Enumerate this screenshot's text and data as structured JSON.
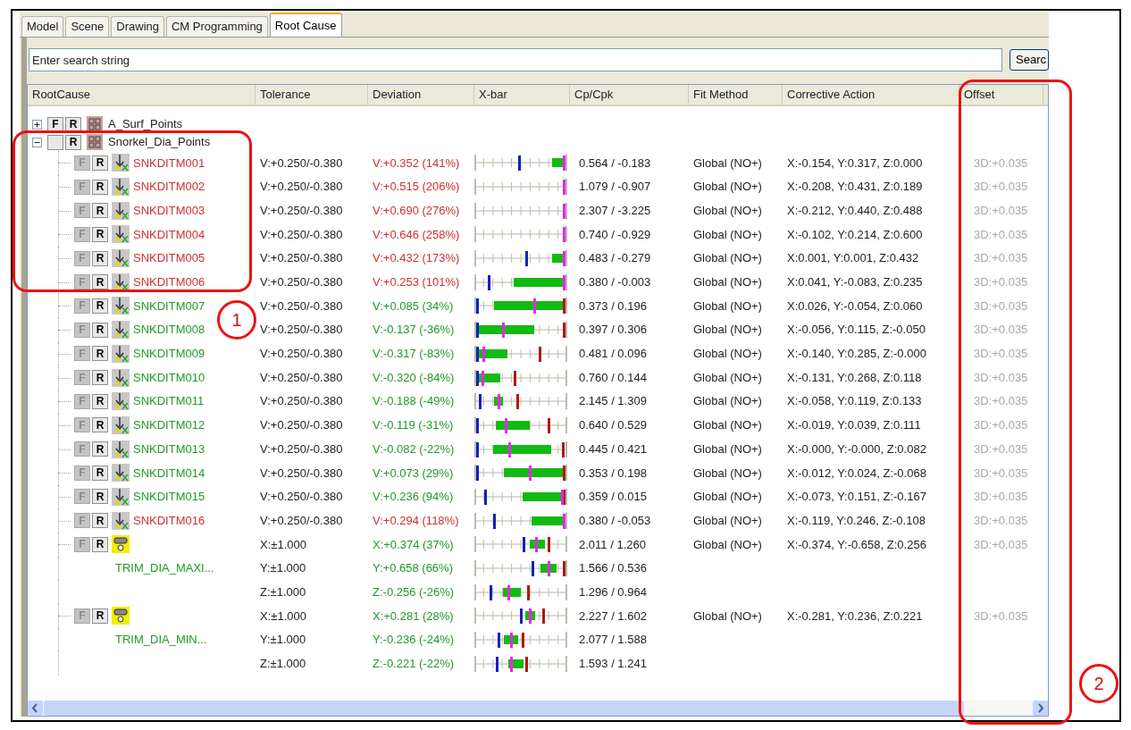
{
  "tabs": [
    {
      "label": "Model",
      "selected": false
    },
    {
      "label": "Scene",
      "selected": false
    },
    {
      "label": "Drawing",
      "selected": false
    },
    {
      "label": "CM Programming",
      "selected": false
    },
    {
      "label": "Root Cause",
      "selected": true
    }
  ],
  "search": {
    "placeholder": "Enter search string",
    "button": "Searc"
  },
  "columns": [
    "RootCause",
    "Tolerance",
    "Deviation",
    "X-bar",
    "Cp/Cpk",
    "Fit Method",
    "Corrective Action",
    "Offset"
  ],
  "tree": [
    {
      "kind": "group",
      "name": "A_Surf_Points",
      "expanded": false,
      "flags": [
        {
          "label": "F",
          "disabled": false
        },
        {
          "label": "R",
          "disabled": false
        }
      ]
    },
    {
      "kind": "group",
      "name": "Snorkel_Dia_Points",
      "expanded": true,
      "flags": [
        {
          "disabled": false
        },
        {
          "label": "R",
          "disabled": false
        }
      ],
      "children": [
        {
          "kind": "point",
          "name": "SNKDITM001",
          "out_of_tolerance": true,
          "tolerance": "V:+0.250/-0.380",
          "deviation": "V:+0.352 (141%)",
          "cp": "0.564 / -0.183",
          "fit": "Global (NO+)",
          "action": "X:-0.154, Y:0.317, Z:0.000",
          "offset": "3D:+0.035",
          "flags": [
            {
              "label": "F",
              "disabled": true
            },
            {
              "label": "R",
              "disabled": false
            }
          ]
        },
        {
          "kind": "point",
          "name": "SNKDITM002",
          "out_of_tolerance": true,
          "tolerance": "V:+0.250/-0.380",
          "deviation": "V:+0.515 (206%)",
          "cp": "1.079 / -0.907",
          "fit": "Global (NO+)",
          "action": "X:-0.208, Y:0.431, Z:0.189",
          "offset": "3D:+0.035",
          "flags": [
            {
              "label": "F",
              "disabled": true
            },
            {
              "label": "R",
              "disabled": false
            }
          ]
        },
        {
          "kind": "point",
          "name": "SNKDITM003",
          "out_of_tolerance": true,
          "tolerance": "V:+0.250/-0.380",
          "deviation": "V:+0.690 (276%)",
          "cp": "2.307 / -3.225",
          "fit": "Global (NO+)",
          "action": "X:-0.212, Y:0.440, Z:0.488",
          "offset": "3D:+0.035",
          "flags": [
            {
              "label": "F",
              "disabled": true
            },
            {
              "label": "R",
              "disabled": false
            }
          ]
        },
        {
          "kind": "point",
          "name": "SNKDITM004",
          "out_of_tolerance": true,
          "tolerance": "V:+0.250/-0.380",
          "deviation": "V:+0.646 (258%)",
          "cp": "0.740 / -0.929",
          "fit": "Global (NO+)",
          "action": "X:-0.102, Y:0.214, Z:0.600",
          "offset": "3D:+0.035",
          "flags": [
            {
              "label": "F",
              "disabled": true
            },
            {
              "label": "R",
              "disabled": false
            }
          ]
        },
        {
          "kind": "point",
          "name": "SNKDITM005",
          "out_of_tolerance": true,
          "tolerance": "V:+0.250/-0.380",
          "deviation": "V:+0.432 (173%)",
          "cp": "0.483 / -0.279",
          "fit": "Global (NO+)",
          "action": "X:0.001, Y:0.001, Z:0.432",
          "offset": "3D:+0.035",
          "flags": [
            {
              "label": "F",
              "disabled": true
            },
            {
              "label": "R",
              "disabled": false
            }
          ]
        },
        {
          "kind": "point",
          "name": "SNKDITM006",
          "out_of_tolerance": true,
          "tolerance": "V:+0.250/-0.380",
          "deviation": "V:+0.253 (101%)",
          "cp": "0.380 / -0.003",
          "fit": "Global (NO+)",
          "action": "X:0.041, Y:-0.083, Z:0.235",
          "offset": "3D:+0.035",
          "flags": [
            {
              "label": "F",
              "disabled": true
            },
            {
              "label": "R",
              "disabled": false
            }
          ]
        },
        {
          "kind": "point",
          "name": "SNKDITM007",
          "out_of_tolerance": false,
          "tolerance": "V:+0.250/-0.380",
          "deviation": "V:+0.085 (34%)",
          "cp": "0.373 / 0.196",
          "fit": "Global (NO+)",
          "action": "X:0.026, Y:-0.054, Z:0.060",
          "offset": "3D:+0.035",
          "flags": [
            {
              "label": "F",
              "disabled": true
            },
            {
              "label": "R",
              "disabled": false
            }
          ]
        },
        {
          "kind": "point",
          "name": "SNKDITM008",
          "out_of_tolerance": false,
          "tolerance": "V:+0.250/-0.380",
          "deviation": "V:-0.137 (-36%)",
          "cp": "0.397 / 0.306",
          "fit": "Global (NO+)",
          "action": "X:-0.056, Y:0.115, Z:-0.050",
          "offset": "3D:+0.035",
          "flags": [
            {
              "label": "F",
              "disabled": true
            },
            {
              "label": "R",
              "disabled": false
            }
          ]
        },
        {
          "kind": "point",
          "name": "SNKDITM009",
          "out_of_tolerance": false,
          "tolerance": "V:+0.250/-0.380",
          "deviation": "V:-0.317 (-83%)",
          "cp": "0.481 / 0.096",
          "fit": "Global (NO+)",
          "action": "X:-0.140, Y:0.285, Z:-0.000",
          "offset": "3D:+0.035",
          "flags": [
            {
              "label": "F",
              "disabled": true
            },
            {
              "label": "R",
              "disabled": false
            }
          ]
        },
        {
          "kind": "point",
          "name": "SNKDITM010",
          "out_of_tolerance": false,
          "tolerance": "V:+0.250/-0.380",
          "deviation": "V:-0.320 (-84%)",
          "cp": "0.760 / 0.144",
          "fit": "Global (NO+)",
          "action": "X:-0.131, Y:0.268, Z:0.118",
          "offset": "3D:+0.035",
          "flags": [
            {
              "label": "F",
              "disabled": true
            },
            {
              "label": "R",
              "disabled": false
            }
          ]
        },
        {
          "kind": "point",
          "name": "SNKDITM011",
          "out_of_tolerance": false,
          "tolerance": "V:+0.250/-0.380",
          "deviation": "V:-0.188 (-49%)",
          "cp": "2.145 / 1.309",
          "fit": "Global (NO+)",
          "action": "X:-0.058, Y:0.119, Z:0.133",
          "offset": "3D:+0.035",
          "flags": [
            {
              "label": "F",
              "disabled": true
            },
            {
              "label": "R",
              "disabled": false
            }
          ]
        },
        {
          "kind": "point",
          "name": "SNKDITM012",
          "out_of_tolerance": false,
          "tolerance": "V:+0.250/-0.380",
          "deviation": "V:-0.119 (-31%)",
          "cp": "0.640 / 0.529",
          "fit": "Global (NO+)",
          "action": "X:-0.019, Y:0.039, Z:0.111",
          "offset": "3D:+0.035",
          "flags": [
            {
              "label": "F",
              "disabled": true
            },
            {
              "label": "R",
              "disabled": false
            }
          ]
        },
        {
          "kind": "point",
          "name": "SNKDITM013",
          "out_of_tolerance": false,
          "tolerance": "V:+0.250/-0.380",
          "deviation": "V:-0.082 (-22%)",
          "cp": "0.445 / 0.421",
          "fit": "Global (NO+)",
          "action": "X:-0.000, Y:-0.000, Z:0.082",
          "offset": "3D:+0.035",
          "flags": [
            {
              "label": "F",
              "disabled": true
            },
            {
              "label": "R",
              "disabled": false
            }
          ]
        },
        {
          "kind": "point",
          "name": "SNKDITM014",
          "out_of_tolerance": false,
          "tolerance": "V:+0.250/-0.380",
          "deviation": "V:+0.073 (29%)",
          "cp": "0.353 / 0.198",
          "fit": "Global (NO+)",
          "action": "X:-0.012, Y:0.024, Z:-0.068",
          "offset": "3D:+0.035",
          "flags": [
            {
              "label": "F",
              "disabled": true
            },
            {
              "label": "R",
              "disabled": false
            }
          ]
        },
        {
          "kind": "point",
          "name": "SNKDITM015",
          "out_of_tolerance": false,
          "tolerance": "V:+0.250/-0.380",
          "deviation": "V:+0.236 (94%)",
          "cp": "0.359 / 0.015",
          "fit": "Global (NO+)",
          "action": "X:-0.073, Y:0.151, Z:-0.167",
          "offset": "3D:+0.035",
          "flags": [
            {
              "label": "F",
              "disabled": true
            },
            {
              "label": "R",
              "disabled": false
            }
          ]
        },
        {
          "kind": "point",
          "name": "SNKDITM016",
          "out_of_tolerance": true,
          "tolerance": "V:+0.250/-0.380",
          "deviation": "V:+0.294 (118%)",
          "cp": "0.380 / -0.053",
          "fit": "Global (NO+)",
          "action": "X:-0.119, Y:0.246, Z:-0.108",
          "offset": "3D:+0.035",
          "flags": [
            {
              "label": "F",
              "disabled": true
            },
            {
              "label": "R",
              "disabled": false
            }
          ]
        },
        {
          "kind": "feature",
          "name": "TRIM_DIA_MAXI...",
          "out_of_tolerance": false,
          "fit": "Global (NO+)",
          "action": "X:-0.374, Y:-0.658, Z:0.256",
          "offset": "3D:+0.035",
          "flags": [
            {
              "label": "F",
              "disabled": true
            },
            {
              "label": "R",
              "disabled": false
            }
          ],
          "axes": [
            {
              "tolerance": "X:±1.000",
              "deviation": "X:+0.374 (37%)",
              "cp": "2.011 / 1.260"
            },
            {
              "tolerance": "Y:±1.000",
              "deviation": "Y:+0.658 (66%)",
              "cp": "1.566 / 0.536"
            },
            {
              "tolerance": "Z:±1.000",
              "deviation": "Z:-0.256 (-26%)",
              "cp": "1.296 / 0.964"
            }
          ]
        },
        {
          "kind": "feature",
          "name": "TRIM_DIA_MIN...",
          "out_of_tolerance": false,
          "fit": "Global (NO+)",
          "action": "X:-0.281, Y:0.236, Z:0.221",
          "offset": "3D:+0.035",
          "flags": [
            {
              "label": "F",
              "disabled": true
            },
            {
              "label": "R",
              "disabled": false
            }
          ],
          "axes": [
            {
              "tolerance": "X:±1.000",
              "deviation": "X:+0.281 (28%)",
              "cp": "2.227 / 1.602"
            },
            {
              "tolerance": "Y:±1.000",
              "deviation": "Y:-0.236 (-24%)",
              "cp": "2.077 / 1.588"
            },
            {
              "tolerance": "Z:±1.000",
              "deviation": "Z:-0.221 (-22%)",
              "cp": "1.593 / 1.241"
            }
          ]
        }
      ]
    }
  ],
  "callouts": [
    {
      "label": "1"
    },
    {
      "label": "2"
    }
  ]
}
